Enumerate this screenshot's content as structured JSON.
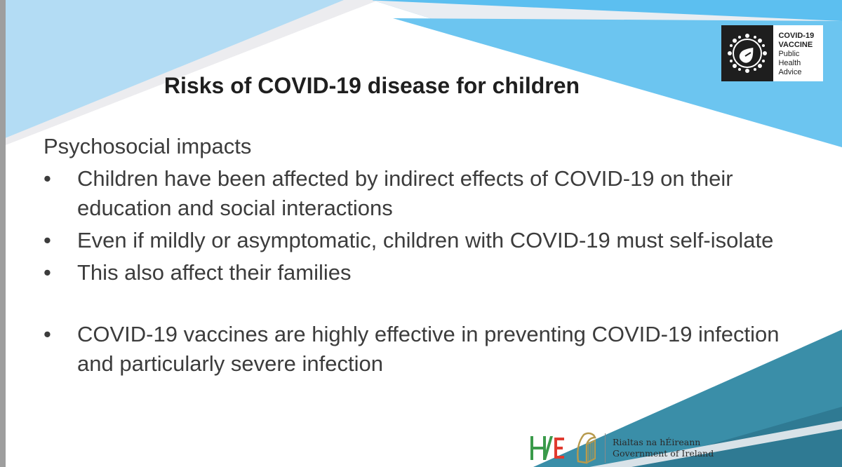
{
  "slide": {
    "title": "Risks of COVID-19 disease for children",
    "subheading": "Psychosocial impacts",
    "bullet_symbol": "•",
    "bullets": [
      "Children have been affected by indirect effects of COVID-19 on their education and social interactions",
      "Even if mildly or asymptomatic, children with COVID-19 must self-isolate",
      "This also affect their families",
      "COVID-19 vaccines are highly effective in preventing COVID-19 infection and particularly severe infection"
    ]
  },
  "logo": {
    "line1": "COVID-19",
    "line2": "VACCINE",
    "line3": "Public Health",
    "line4": "Advice",
    "icon": "vaccine-droplet-icon"
  },
  "footer": {
    "hse_logo": "hse-logo",
    "harp_logo": "harp-icon",
    "gov_line1": "Rialtas na hÉireann",
    "gov_line2": "Government of Ireland"
  },
  "colors": {
    "light_blue": "#a8d8f0",
    "sky_blue": "#5bbcea",
    "teal": "#3d8fa8",
    "dark_teal": "#2b6f86",
    "hse_green": "#3a9a4a",
    "hse_red": "#e03a2f",
    "harp_gold": "#b79a4d"
  }
}
